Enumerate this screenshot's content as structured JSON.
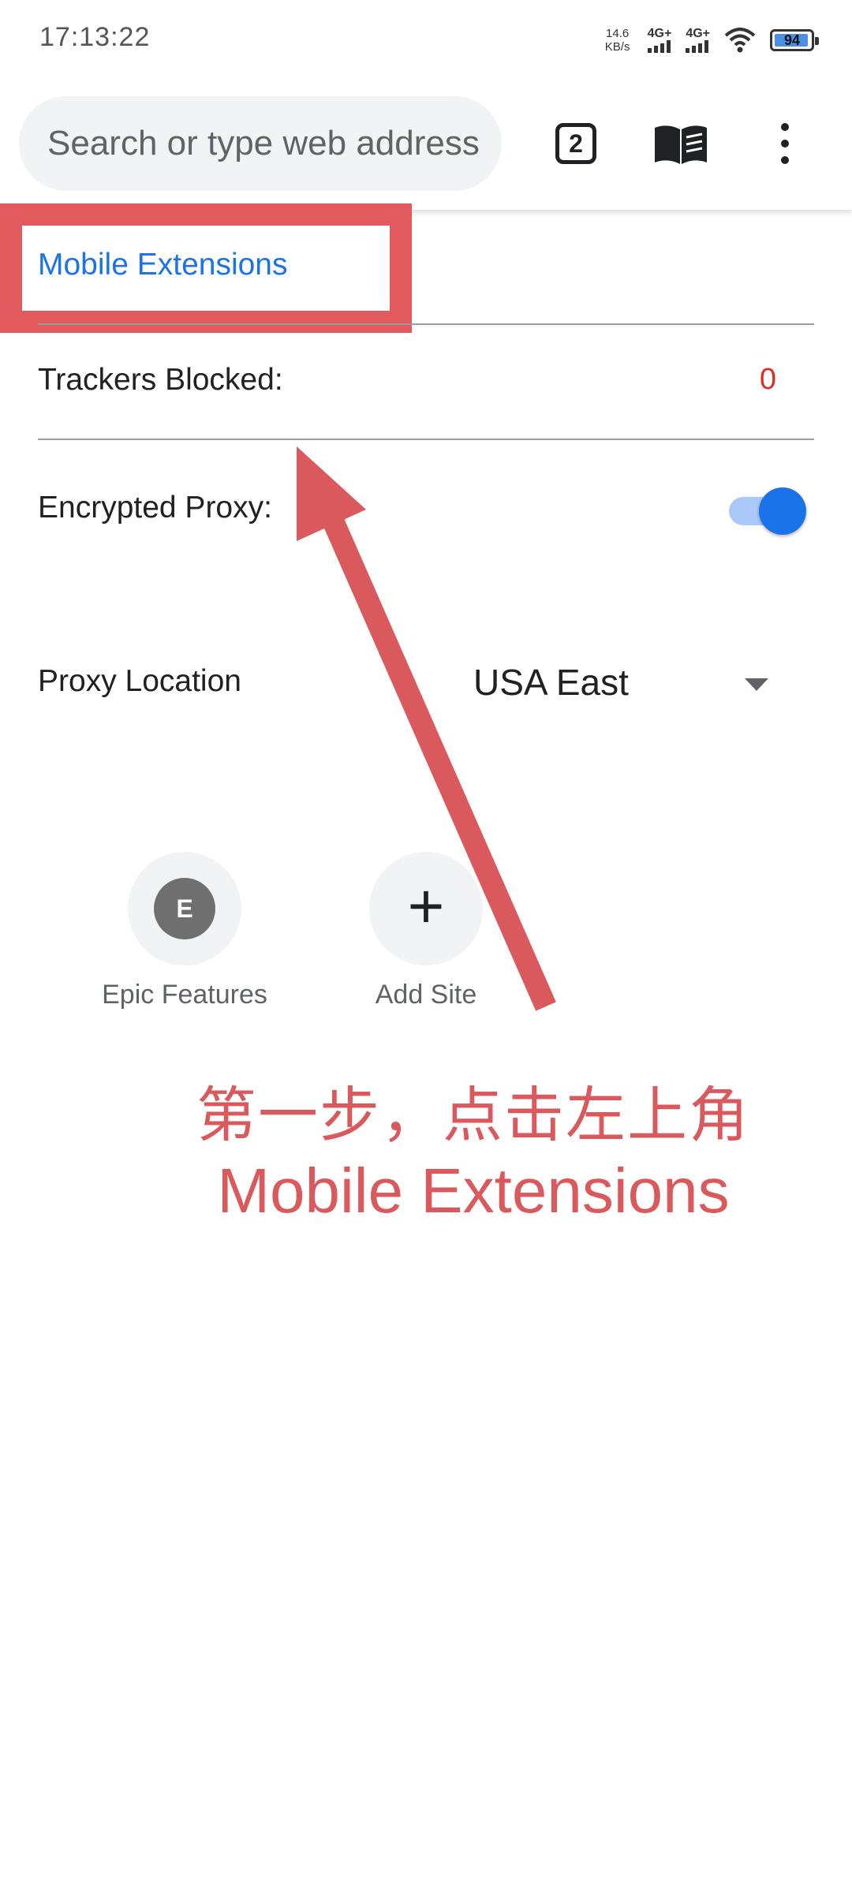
{
  "status_bar": {
    "time": "17:13:22",
    "net_speed_value": "14.6",
    "net_speed_unit": "KB/s",
    "signal_1": "4G+",
    "signal_2": "4G+",
    "battery": "94"
  },
  "toolbar": {
    "search_placeholder": "Search or type web address",
    "tab_count": "2",
    "icons": [
      "tab-switcher-icon",
      "reader-mode-icon",
      "more-vert-icon"
    ]
  },
  "panel": {
    "title": "Mobile Extensions",
    "trackers_label": "Trackers Blocked:",
    "trackers_count": "0",
    "proxy_label": "Encrypted Proxy:",
    "proxy_enabled": true,
    "proxy_location_label": "Proxy Location",
    "proxy_location_value": "USA East"
  },
  "shortcuts": [
    {
      "label": "Epic Features",
      "icon_letter": "E"
    },
    {
      "label": "Add Site",
      "icon": "plus-icon"
    }
  ],
  "annotation": {
    "line1": "第一步，点击左上角",
    "line2": "Mobile Extensions",
    "color": "#d9595d"
  },
  "colors": {
    "accent": "#1a73e8",
    "highlight": "#e05a5e",
    "tracker_count": "#d93025"
  }
}
